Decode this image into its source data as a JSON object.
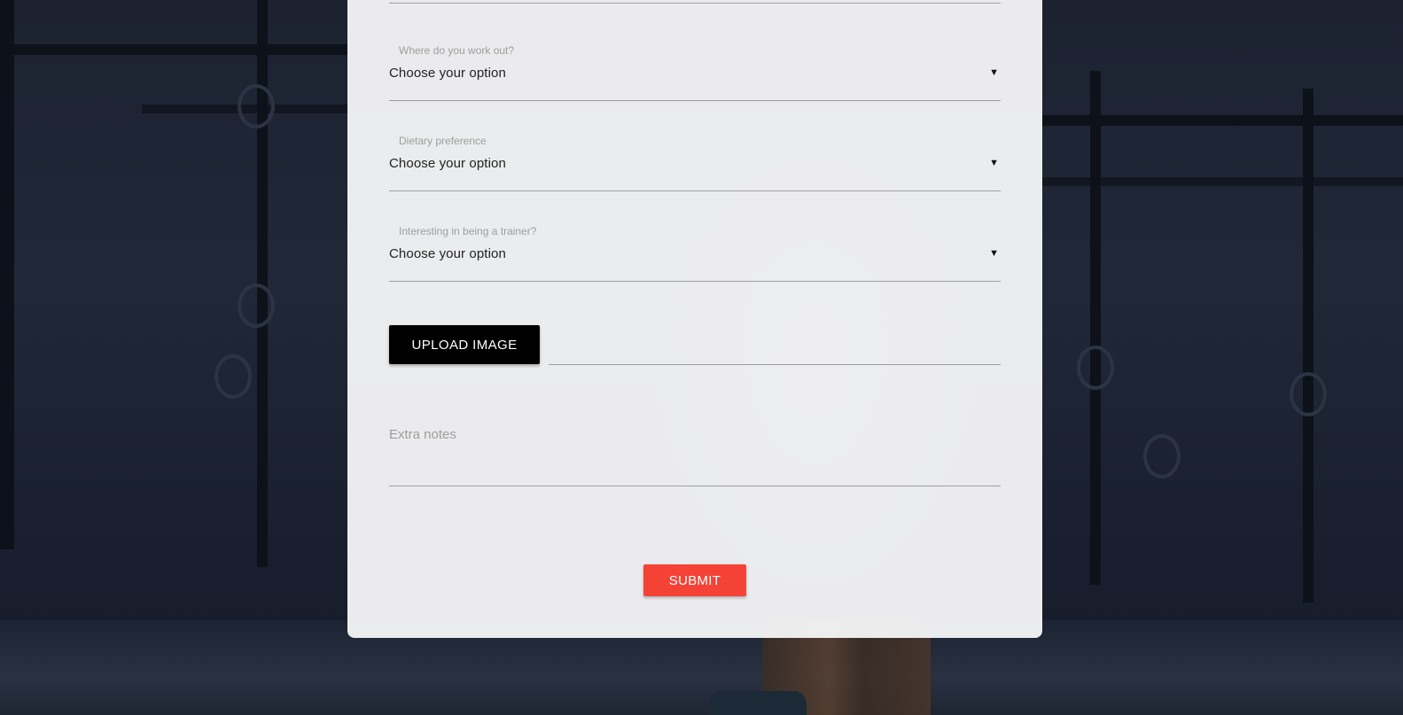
{
  "form": {
    "selects": [
      {
        "label": "Where do you work out?",
        "value": "Choose your option",
        "icon": "caret-down-icon"
      },
      {
        "label": "Dietary preference",
        "value": "Choose your option",
        "icon": "caret-down-icon"
      },
      {
        "label": "Interesting in being a trainer?",
        "value": "Choose your option",
        "icon": "caret-down-icon"
      }
    ],
    "caret_glyph": "▼",
    "upload_label": "UPLOAD IMAGE",
    "upload_path_value": "",
    "notes_placeholder": "Extra notes",
    "submit_label": "SUBMIT"
  },
  "colors": {
    "submit": "#f44336",
    "upload": "#000000",
    "panel": "#f7f7f8"
  }
}
